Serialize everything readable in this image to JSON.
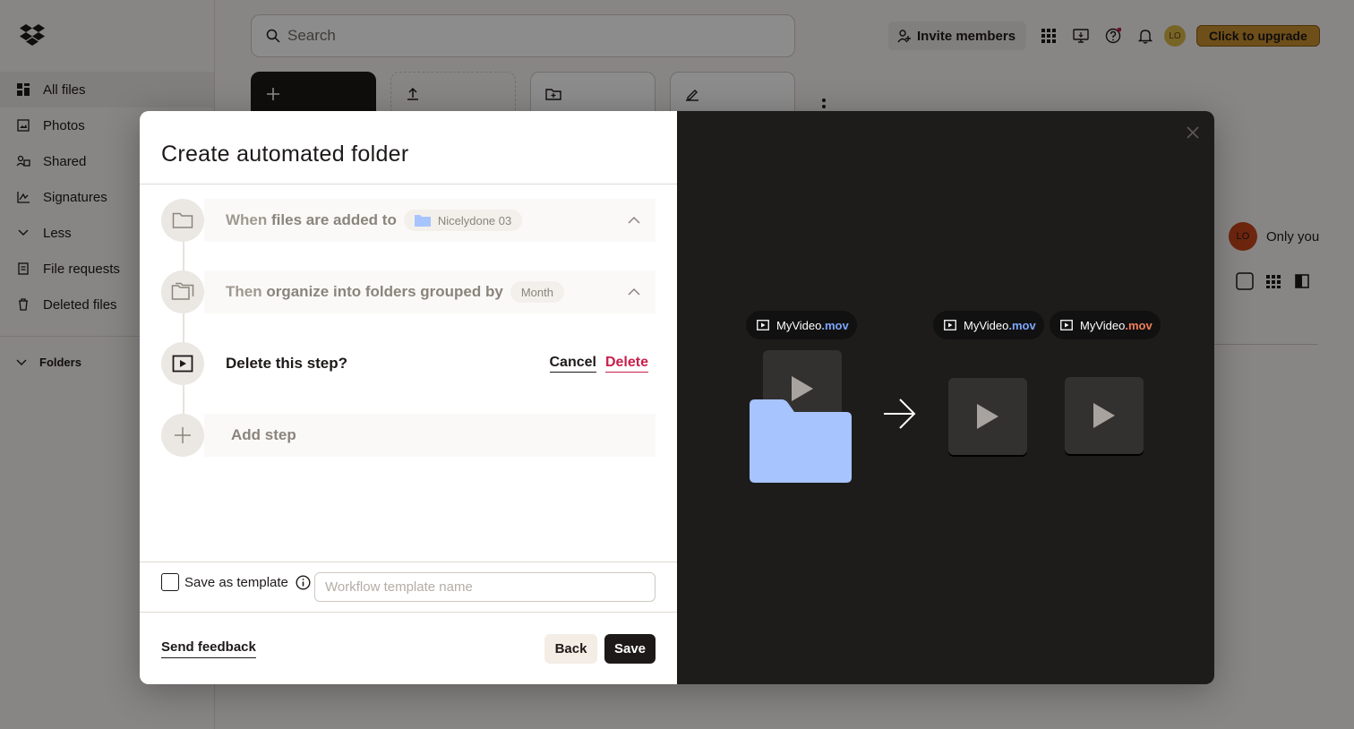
{
  "sidebar": {
    "items": [
      {
        "label": "All files",
        "icon": "all-files-icon",
        "active": true
      },
      {
        "label": "Photos",
        "icon": "photos-icon"
      },
      {
        "label": "Shared",
        "icon": "shared-icon"
      },
      {
        "label": "Signatures",
        "icon": "signature-icon"
      },
      {
        "label": "Less",
        "icon": "chevron-down-icon"
      },
      {
        "label": "File requests",
        "icon": "file-request-icon"
      },
      {
        "label": "Deleted files",
        "icon": "trash-icon"
      }
    ],
    "folders_label": "Folders"
  },
  "header": {
    "search_placeholder": "Search",
    "invite_label": "Invite members",
    "avatar_initials": "LO",
    "upgrade_label": "Click to upgrade"
  },
  "content": {
    "owner_initials": "LO",
    "owner_label": "Only you"
  },
  "modal": {
    "title": "Create automated folder",
    "step1": {
      "prefix": "When",
      "text": "files are added to",
      "folder_chip": "Nicelydone 03"
    },
    "step2": {
      "prefix": "Then",
      "text": "organize into folders grouped by",
      "chip": "Month"
    },
    "step3": {
      "text": "Delete this step?",
      "cancel_label": "Cancel",
      "delete_label": "Delete"
    },
    "add_step_label": "Add step",
    "save_template_label": "Save as template",
    "template_placeholder": "Workflow template name",
    "feedback_label": "Send feedback",
    "back_label": "Back",
    "save_label": "Save",
    "illustration": {
      "file1": {
        "name": "MyVideo",
        "ext": ".mov"
      },
      "file2": {
        "name": "MyVideo",
        "ext": ".mov"
      },
      "file3": {
        "name": "MyVideo",
        "ext": ".mov"
      }
    }
  },
  "colors": {
    "accent_blue": "#7da5ff",
    "folder_blue": "#a7c4ff",
    "delete_red": "#c8204b",
    "upgrade_gold": "#c9902f",
    "ext_orange": "#f07f5a"
  }
}
